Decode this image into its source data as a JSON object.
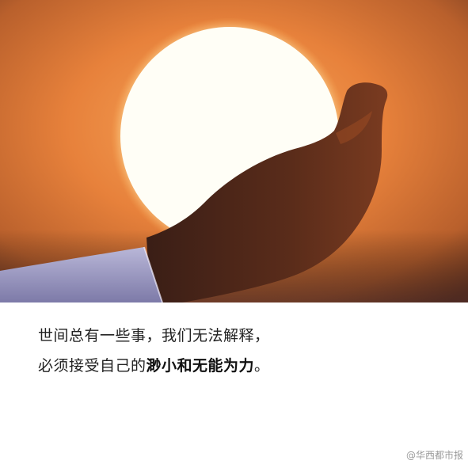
{
  "caption": {
    "line1": "世间总有一些事，我们无法解释，",
    "line2_prefix": "必须接受自己的",
    "line2_emphasis": "渺小和无能为力",
    "line2_suffix": "。"
  },
  "watermark": {
    "text": "@华西都市报"
  }
}
